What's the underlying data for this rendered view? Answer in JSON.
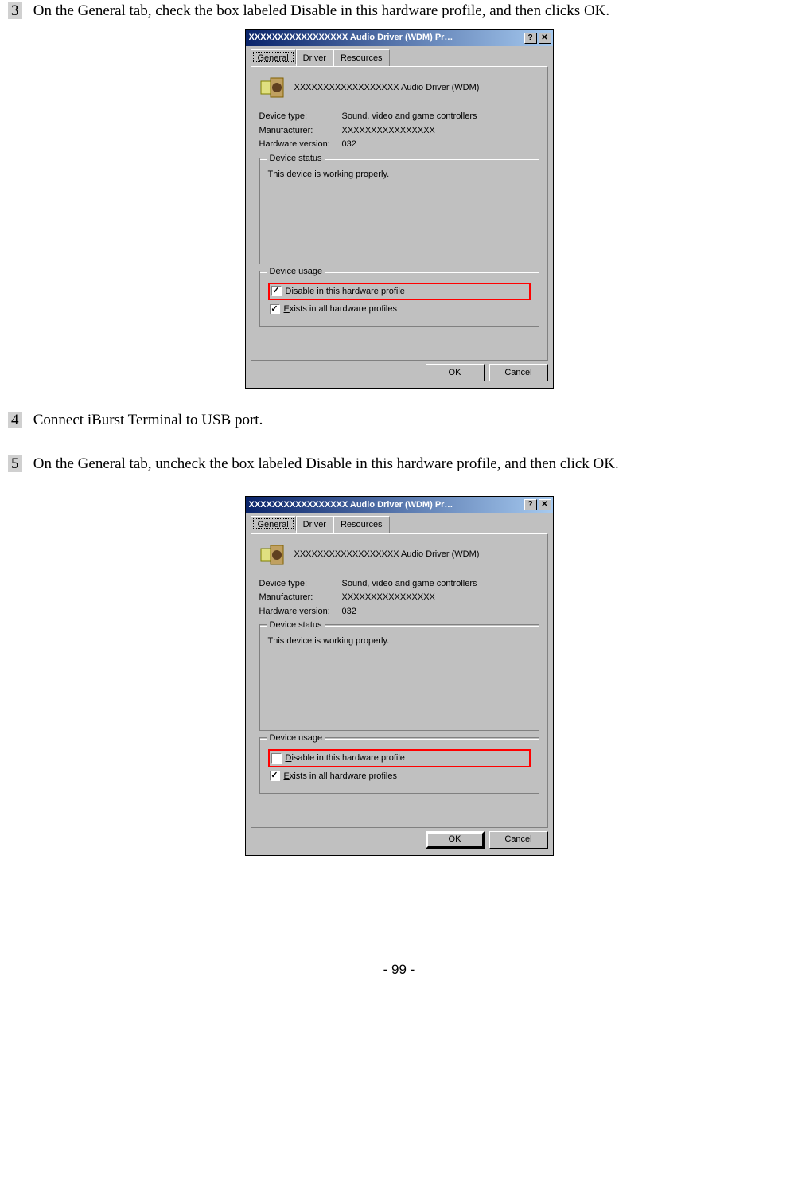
{
  "steps": {
    "s3": {
      "num": "3",
      "text": "On the General tab, check the box labeled Disable in this hardware profile, and then clicks OK."
    },
    "s4": {
      "num": "4",
      "text": "Connect iBurst Terminal to USB port."
    },
    "s5": {
      "num": "5",
      "text": "On the General tab, uncheck the box labeled Disable in this hardware profile, and then click OK."
    }
  },
  "dialog": {
    "title": "XXXXXXXXXXXXXXXXX   Audio Driver (WDM) Pr…",
    "tabs": {
      "general": "General",
      "driver": "Driver",
      "resources": "Resources"
    },
    "device_name": "XXXXXXXXXXXXXXXXXX    Audio Driver (WDM)",
    "labels": {
      "type": "Device type:",
      "mfg": "Manufacturer:",
      "hw": "Hardware version:"
    },
    "values": {
      "type": "Sound, video and game controllers",
      "mfg": "XXXXXXXXXXXXXXXX",
      "hw": "032"
    },
    "status_legend": "Device status",
    "status_text": "This device is working properly.",
    "usage_legend": "Device usage",
    "disable_label": "Disable in this hardware profile",
    "exists_label": "Exists in all hardware profiles",
    "buttons": {
      "ok": "OK",
      "cancel": "Cancel"
    },
    "titlebar_buttons": {
      "help": "?",
      "close": "✕"
    }
  },
  "page_number": "- 99 -"
}
